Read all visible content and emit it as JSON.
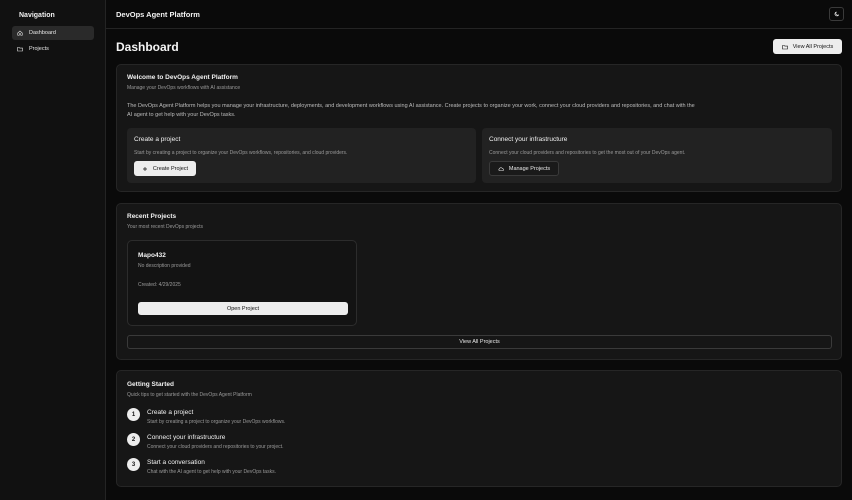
{
  "sidebar": {
    "title": "Navigation",
    "items": [
      {
        "label": "Dashboard",
        "icon": "home-icon",
        "active": true
      },
      {
        "label": "Projects",
        "icon": "folder-icon",
        "active": false
      }
    ]
  },
  "header": {
    "app_title": "DevOps Agent Platform",
    "theme_icon": "moon-icon"
  },
  "page": {
    "title": "Dashboard",
    "view_all_label": "View All Projects"
  },
  "welcome": {
    "title": "Welcome to DevOps Agent Platform",
    "subtitle": "Manage your DevOps workflows with AI assistance",
    "description_line1": "The DevOps Agent Platform helps you manage your infrastructure, deployments, and development workflows using AI assistance. Create projects to organize your work, connect your cloud providers and repositories, and chat with the",
    "description_line2": "AI agent to get help with your DevOps tasks.",
    "create": {
      "title": "Create a project",
      "text": "Start by creating a project to organize your DevOps workflows, repositories, and cloud providers.",
      "button": "Create Project"
    },
    "connect": {
      "title": "Connect your infrastructure",
      "text": "Connect your cloud providers and repositories to get the most out of your DevOps agent.",
      "button": "Manage Projects"
    }
  },
  "recent": {
    "title": "Recent Projects",
    "subtitle": "Your most recent DevOps projects",
    "project": {
      "name": "Mapo432",
      "description": "No description provided",
      "created": "Created: 4/29/2025",
      "button": "Open Project"
    },
    "view_all": "View All Projects"
  },
  "getting_started": {
    "title": "Getting Started",
    "subtitle": "Quick tips to get started with the DevOps Agent Platform",
    "steps": [
      {
        "num": "1",
        "title": "Create a project",
        "text": "Start by creating a project to organize your DevOps workflows."
      },
      {
        "num": "2",
        "title": "Connect your infrastructure",
        "text": "Connect your cloud providers and repositories to your project."
      },
      {
        "num": "3",
        "title": "Start a conversation",
        "text": "Chat with the AI agent to get help with your DevOps tasks."
      }
    ]
  }
}
